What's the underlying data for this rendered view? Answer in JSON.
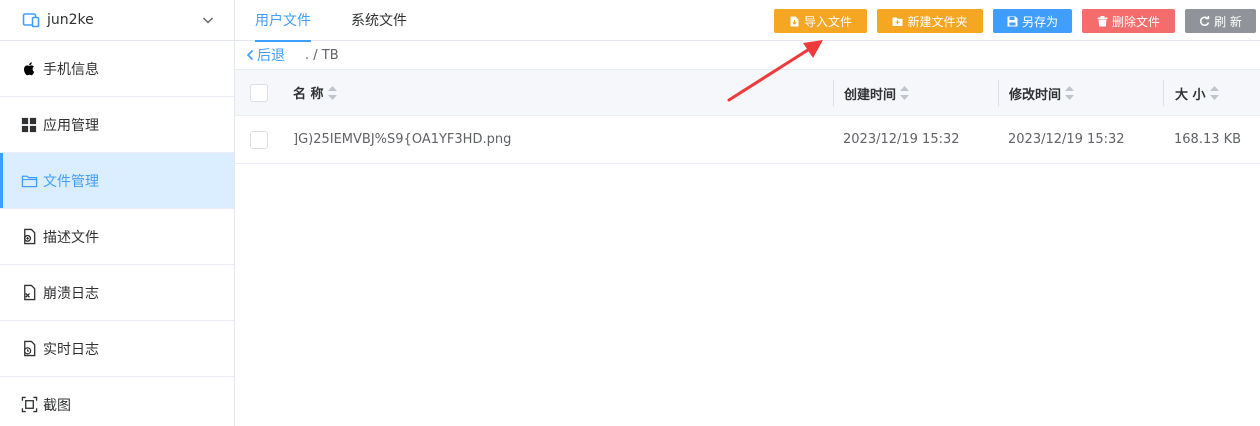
{
  "sidebar": {
    "device_name": "jun2ke",
    "items": [
      {
        "label": "手机信息",
        "icon": "apple-icon"
      },
      {
        "label": "应用管理",
        "icon": "apps-grid-icon"
      },
      {
        "label": "文件管理",
        "icon": "folder-icon",
        "active": true
      },
      {
        "label": "描述文件",
        "icon": "profile-file-icon"
      },
      {
        "label": "崩溃日志",
        "icon": "crash-log-icon"
      },
      {
        "label": "实时日志",
        "icon": "realtime-log-icon"
      },
      {
        "label": "截图",
        "icon": "screenshot-icon"
      }
    ]
  },
  "tabs": [
    {
      "label": "用户文件",
      "active": true
    },
    {
      "label": "系统文件",
      "active": false
    }
  ],
  "toolbar": {
    "import_label": "导入文件",
    "new_folder_label": "新建文件夹",
    "save_as_label": "另存为",
    "delete_label": "删除文件",
    "refresh_label": "刷 新"
  },
  "breadcrumb": {
    "back_label": "后退",
    "path": ". / TB"
  },
  "table": {
    "headers": {
      "name": "名 称",
      "created": "创建时间",
      "modified": "修改时间",
      "size": "大 小"
    },
    "rows": [
      {
        "name": "]G)25IEMVBJ%S9{OA1YF3HD.png",
        "created": "2023/12/19 15:32",
        "modified": "2023/12/19 15:32",
        "size": "168.13 KB"
      }
    ]
  },
  "colors": {
    "accent": "#409eff",
    "warning": "#f5a623",
    "danger": "#f56c6c",
    "info": "#909399",
    "annotation": "#ee3a3a"
  }
}
